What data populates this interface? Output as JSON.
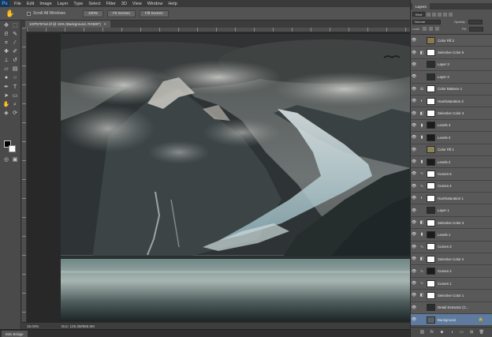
{
  "app": {
    "logo": "Ps",
    "menus": [
      "File",
      "Edit",
      "Image",
      "Layer",
      "Type",
      "Select",
      "Filter",
      "3D",
      "View",
      "Window",
      "Help"
    ],
    "window_controls": [
      "–",
      "□",
      "×"
    ]
  },
  "options_bar": {
    "tool_icon": "hand-icon",
    "scroll_all_windows": "Scroll All Windows",
    "buttons": [
      "100%",
      "Fit Screen",
      "Fill Screen"
    ]
  },
  "document": {
    "tab_title": "1GP5787a2.tif @ 15% (Background, RGB/8*)",
    "tab_close": "×",
    "zoom": "15.04%",
    "doc_size": "Doc: 125.3M/865.6M"
  },
  "bottom_bar": {
    "mini_bridge": "Mini Bridge"
  },
  "layers_panel": {
    "tab_label": "Layers",
    "filter_kind": "Kind",
    "blend_mode": "Normal",
    "opacity_label": "Opacity:",
    "lock_label": "Lock:",
    "fill_label": "Fill:",
    "layers": [
      {
        "name": "Color Fill 2",
        "icon": "none",
        "thumb": "tan"
      },
      {
        "name": "Selective Color 5",
        "icon": "adjust-icon",
        "thumb": "mask-white"
      },
      {
        "name": "Layer 3",
        "icon": "none",
        "thumb": "dark-photo"
      },
      {
        "name": "Layer 2",
        "icon": "none",
        "thumb": "dark-photo"
      },
      {
        "name": "Color Balance 1",
        "icon": "balance-icon",
        "thumb": "mask-white"
      },
      {
        "name": "Hue/Saturation 2",
        "icon": "hue-icon",
        "thumb": "mask-white"
      },
      {
        "name": "Selective Color 4",
        "icon": "adjust-icon",
        "thumb": "mask-white"
      },
      {
        "name": "Levels 4",
        "icon": "levels-icon",
        "thumb": "mask-dark"
      },
      {
        "name": "Levels 3",
        "icon": "levels-icon",
        "thumb": "mask-dark"
      },
      {
        "name": "Color Fill 1",
        "icon": "none",
        "thumb": "olive"
      },
      {
        "name": "Levels 2",
        "icon": "levels-icon",
        "thumb": "mask-dark"
      },
      {
        "name": "Curves 5",
        "icon": "curves-icon",
        "thumb": "mask-white"
      },
      {
        "name": "Curves 4",
        "icon": "curves-icon",
        "thumb": "mask-white"
      },
      {
        "name": "Hue/Saturation 1",
        "icon": "hue-icon",
        "thumb": "mask-white"
      },
      {
        "name": "Layer 1",
        "icon": "none",
        "thumb": "dark-photo"
      },
      {
        "name": "Selective Color 3",
        "icon": "adjust-icon",
        "thumb": "mask-white"
      },
      {
        "name": "Levels 1",
        "icon": "levels-icon",
        "thumb": "mask-dark"
      },
      {
        "name": "Curves 3",
        "icon": "curves-icon",
        "thumb": "mask-white"
      },
      {
        "name": "Selective Color 2",
        "icon": "adjust-icon",
        "thumb": "mask-white"
      },
      {
        "name": "Curves 2",
        "icon": "curves-icon",
        "thumb": "mask-dark"
      },
      {
        "name": "Curves 1",
        "icon": "curves-icon",
        "thumb": "mask-white"
      },
      {
        "name": "Selective Color 1",
        "icon": "adjust-icon",
        "thumb": "mask-white"
      },
      {
        "name": "Detail Extractor (C...",
        "icon": "none",
        "thumb": "dark-photo"
      },
      {
        "name": "Background",
        "icon": "none",
        "thumb": "photo",
        "selected": true,
        "locked": true
      }
    ],
    "footer_icons": [
      "link-icon",
      "fx-icon",
      "mask-icon",
      "adjustment-icon",
      "folder-icon",
      "new-layer-icon",
      "trash-icon"
    ]
  },
  "colors": {
    "selected_layer": "#5e7a9e",
    "panel_bg": "#535353",
    "app_bg": "#454545"
  }
}
